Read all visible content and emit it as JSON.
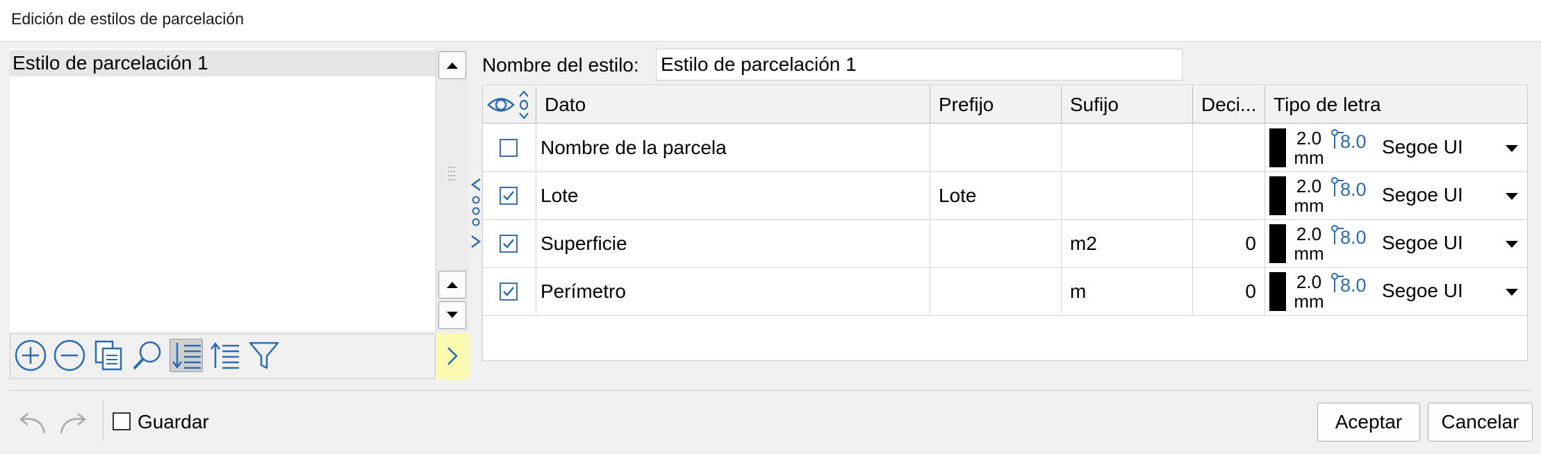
{
  "window": {
    "title": "Edición de estilos de parcelación"
  },
  "style_list": {
    "items": [
      "Estilo de parcelación 1"
    ]
  },
  "style_name": {
    "label": "Nombre del estilo:",
    "value": "Estilo de parcelación 1"
  },
  "grid": {
    "headers": {
      "visibility": "",
      "dato": "Dato",
      "prefijo": "Prefijo",
      "sufijo": "Sufijo",
      "decimales": "Deci...",
      "tipo_letra": "Tipo de letra"
    },
    "rows": [
      {
        "visible": false,
        "dato": "Nombre de la parcela",
        "prefijo": "",
        "sufijo": "",
        "decimales": "",
        "font_size": "2.0",
        "font_unit": "mm",
        "font_base": "8.0",
        "font_name": "Segoe UI"
      },
      {
        "visible": true,
        "dato": "Lote",
        "prefijo": "Lote",
        "sufijo": "",
        "decimales": "",
        "font_size": "2.0",
        "font_unit": "mm",
        "font_base": "8.0",
        "font_name": "Segoe UI"
      },
      {
        "visible": true,
        "dato": "Superficie",
        "prefijo": "",
        "sufijo": "m2",
        "decimales": "0",
        "font_size": "2.0",
        "font_unit": "mm",
        "font_base": "8.0",
        "font_name": "Segoe UI"
      },
      {
        "visible": true,
        "dato": "Perímetro",
        "prefijo": "",
        "sufijo": "m",
        "decimales": "0",
        "font_size": "2.0",
        "font_unit": "mm",
        "font_base": "8.0",
        "font_name": "Segoe UI"
      }
    ]
  },
  "toolbar": {
    "icons": [
      "add-icon",
      "remove-icon",
      "copy-icon",
      "search-icon",
      "sort-descending-icon",
      "sort-ascending-icon",
      "filter-icon"
    ]
  },
  "footer": {
    "save_label": "Guardar",
    "save_checked": false,
    "accept_label": "Aceptar",
    "cancel_label": "Cancelar"
  },
  "colors": {
    "accent": "#2a6bb0",
    "expand_button": "#fafab0",
    "dialog_bg": "#f0f0f0"
  }
}
